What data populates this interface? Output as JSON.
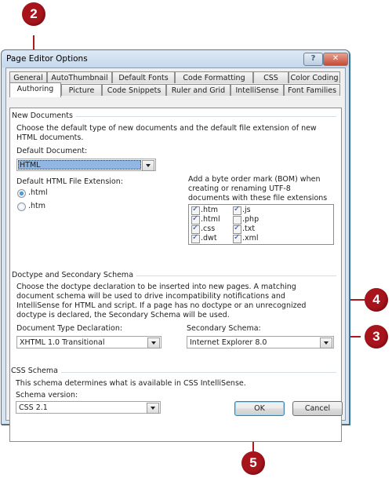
{
  "window": {
    "title": "Page Editor Options",
    "help_label": "?",
    "close_label": "✕"
  },
  "tabs": {
    "row1": [
      {
        "label": "General"
      },
      {
        "label": "AutoThumbnail"
      },
      {
        "label": "Default Fonts"
      },
      {
        "label": "Code Formatting"
      },
      {
        "label": "CSS"
      },
      {
        "label": "Color Coding"
      }
    ],
    "row2": [
      {
        "label": "Authoring",
        "active": true
      },
      {
        "label": "Picture"
      },
      {
        "label": "Code Snippets"
      },
      {
        "label": "Ruler and Grid"
      },
      {
        "label": "IntelliSense"
      },
      {
        "label": "Font Families"
      }
    ]
  },
  "new_documents": {
    "group_label": "New Documents",
    "description": "Choose the default type of new documents and the default file extension of new HTML documents.",
    "default_document_label": "Default Document:",
    "default_document_value": "HTML",
    "extension_label": "Default HTML File Extension:",
    "extension_options": [
      {
        "label": ".html",
        "selected": true
      },
      {
        "label": ".htm",
        "selected": false
      }
    ],
    "bom_label": "Add a byte order mark (BOM) when creating or renaming UTF-8 documents with these file extensions",
    "bom_extensions": [
      {
        "label": ".htm",
        "checked": true
      },
      {
        "label": ".html",
        "checked": true
      },
      {
        "label": ".css",
        "checked": true
      },
      {
        "label": ".dwt",
        "checked": true
      },
      {
        "label": ".js",
        "checked": true
      },
      {
        "label": ".php",
        "checked": false
      },
      {
        "label": ".txt",
        "checked": true
      },
      {
        "label": ".xml",
        "checked": true
      }
    ]
  },
  "doctype": {
    "group_label": "Doctype and Secondary Schema",
    "description": "Choose the doctype declaration to be inserted into new pages. A matching document schema will be used to drive incompatibility notifications and IntelliSense for HTML and script. If a page has no doctype or an unrecognized doctype is declared, the Secondary Schema will be used.",
    "doctype_label": "Document Type Declaration:",
    "doctype_value": "XHTML 1.0 Transitional",
    "secondary_label": "Secondary Schema:",
    "secondary_value": "Internet Explorer 8.0"
  },
  "css_schema": {
    "group_label": "CSS Schema",
    "description": "This schema determines what is available in CSS IntelliSense.",
    "version_label": "Schema version:",
    "version_value": "CSS 2.1"
  },
  "buttons": {
    "ok": "OK",
    "cancel": "Cancel"
  },
  "callouts": {
    "c2": "2",
    "c3": "3",
    "c4": "4",
    "c5": "5",
    "color": "#a8141c"
  }
}
